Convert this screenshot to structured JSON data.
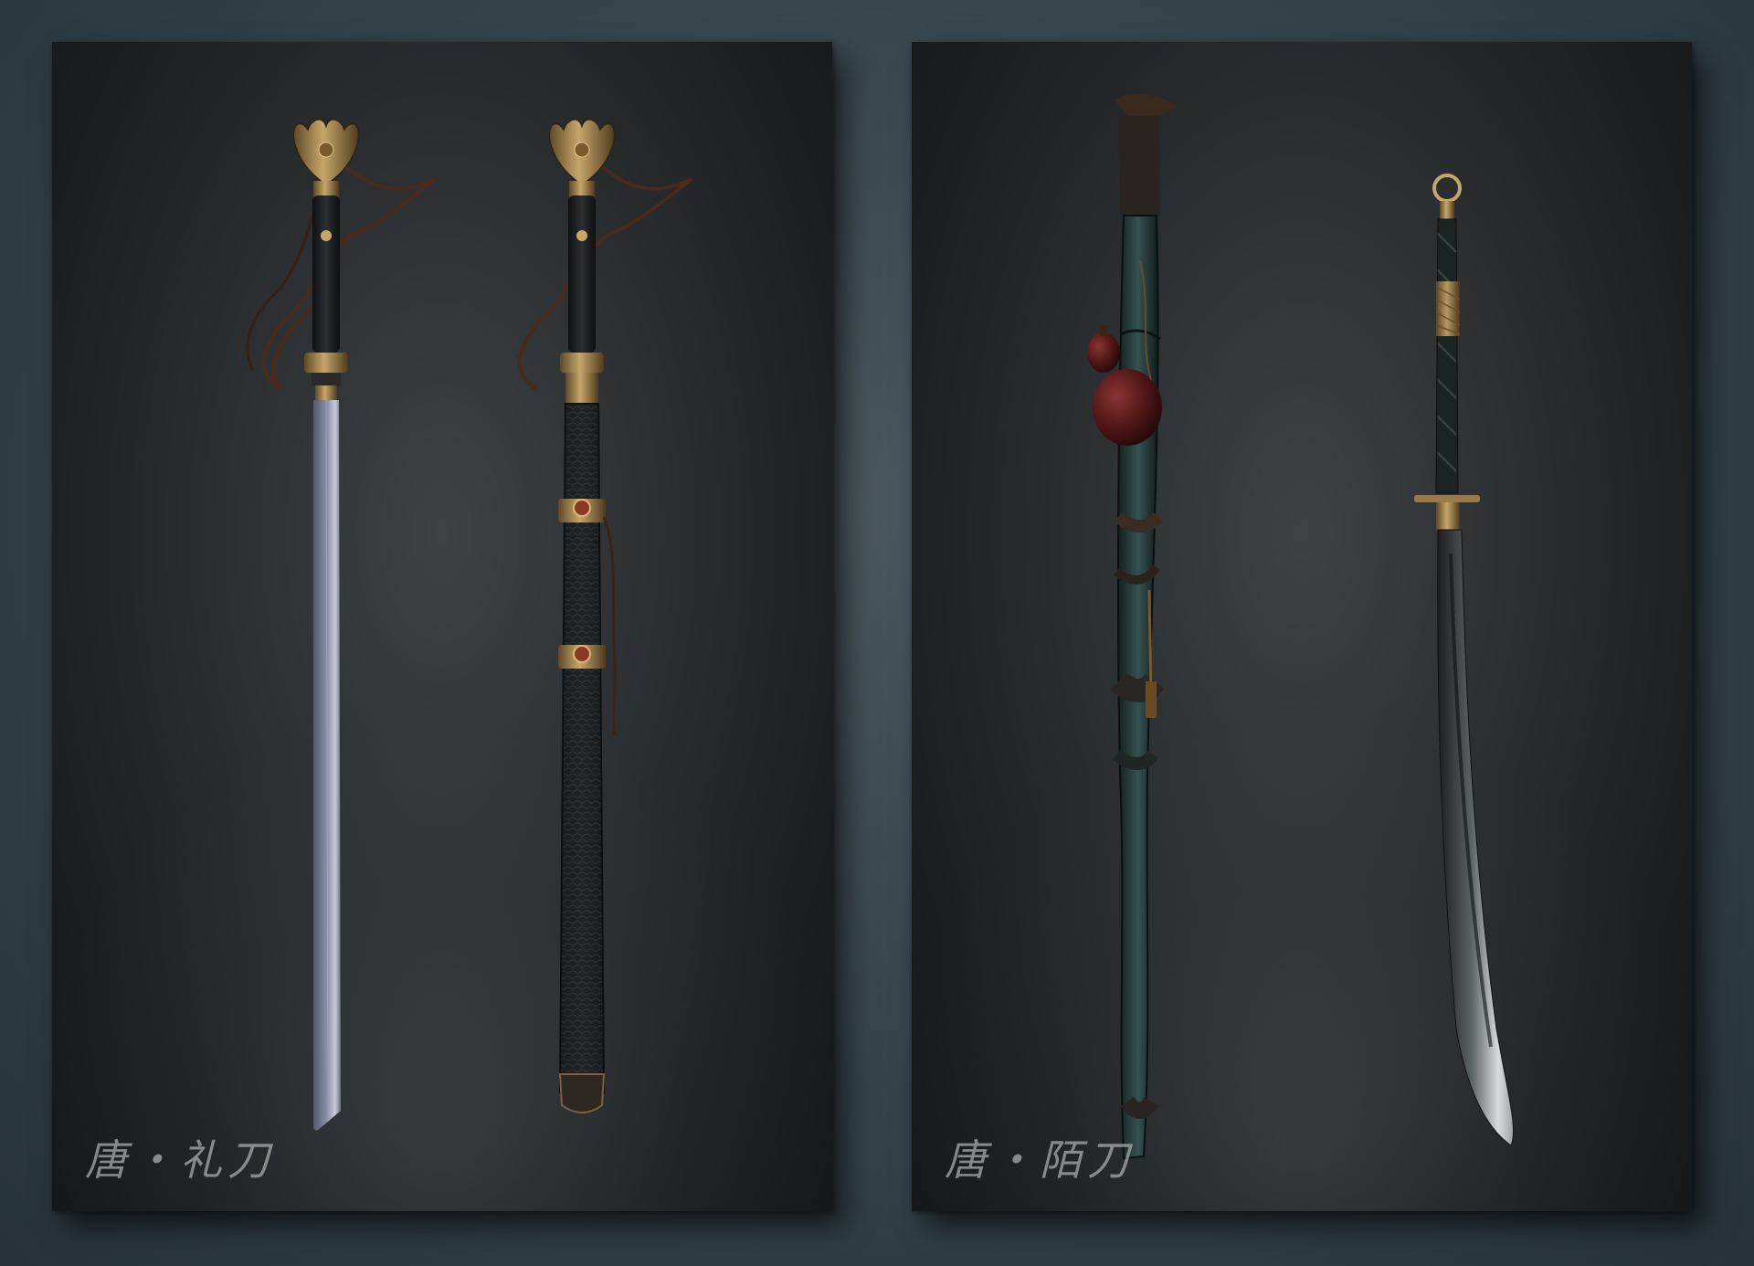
{
  "panels": [
    {
      "caption": "唐・礼刀",
      "items": [
        "drawn-ceremonial-sword",
        "sheathed-ceremonial-sword"
      ]
    },
    {
      "caption": "唐・陌刀",
      "items": [
        "wrapped-staff-with-gourd",
        "long-curved-blade"
      ]
    }
  ],
  "colors": {
    "background": "#2e3a40",
    "panel_dark": "#1c1e20",
    "gold": "#b8955a",
    "blade": "#8a8fa6",
    "teal_wrap": "#2f4a4a",
    "gourd": "#5a1c1c"
  }
}
